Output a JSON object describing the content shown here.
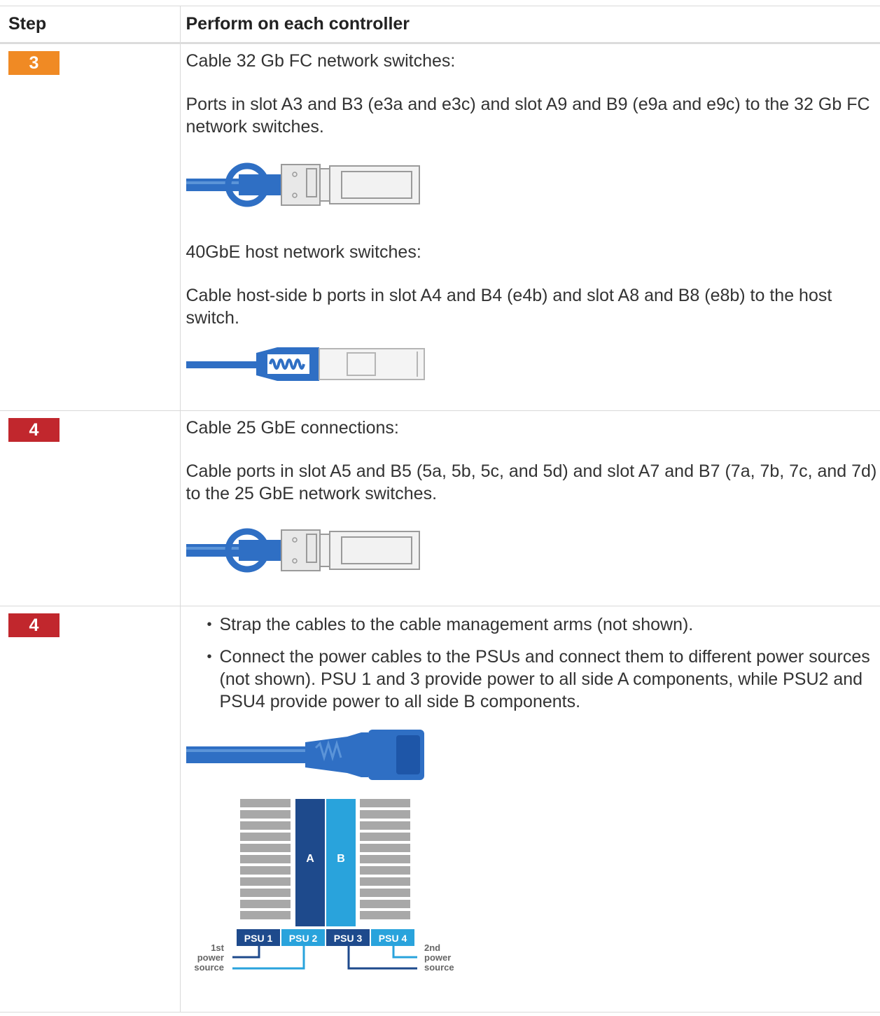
{
  "table": {
    "headers": [
      "Step",
      "Perform on each controller"
    ],
    "rows": [
      {
        "step": "3",
        "badge_color": "#f08a24",
        "heading1": "Cable 32 Gb FC network switches:",
        "text1": "Ports in slot A3 and B3 (e3a and e3c) and slot A9 and B9 (e9a and e9c) to the 32 Gb FC network switches.",
        "image1": "sfp-cable-icon",
        "heading2": "40GbE host network switches:",
        "text2": "Cable host-side b ports in slot A4 and B4 (e4b) and slot A8 and B8 (e8b) to the host switch.",
        "image2": "qsfp-cable-icon"
      },
      {
        "step": "4",
        "badge_color": "#c1272d",
        "heading1": "Cable 25 GbE connections:",
        "text1": "Cable ports in slot A5 and B5 (5a, 5b, 5c, and 5d) and slot A7 and B7 (7a, 7b, 7c, and 7d) to the 25 GbE network switches.",
        "image1": "sfp-cable-icon"
      },
      {
        "step": "4",
        "badge_color": "#c1272d",
        "bullets": [
          "Strap the cables to the cable management arms (not shown).",
          "Connect the power cables to the PSUs and connect them to different power sources (not shown). PSU 1 and 3 provide power to all side A components, while PSU2 and PSU4 provide power to all side B components."
        ],
        "image1": "power-cable-icon",
        "diagram": {
          "side_a": "A",
          "side_b": "B",
          "psus": [
            "PSU 1",
            "PSU 2",
            "PSU 3",
            "PSU 4"
          ],
          "source1": [
            "1st",
            "power",
            "source"
          ],
          "source2": [
            "2nd",
            "power",
            "source"
          ],
          "colors": {
            "side_a": "#1e4a8c",
            "side_b": "#29a3dc",
            "fins": "#a8a8a8"
          }
        }
      }
    ]
  }
}
